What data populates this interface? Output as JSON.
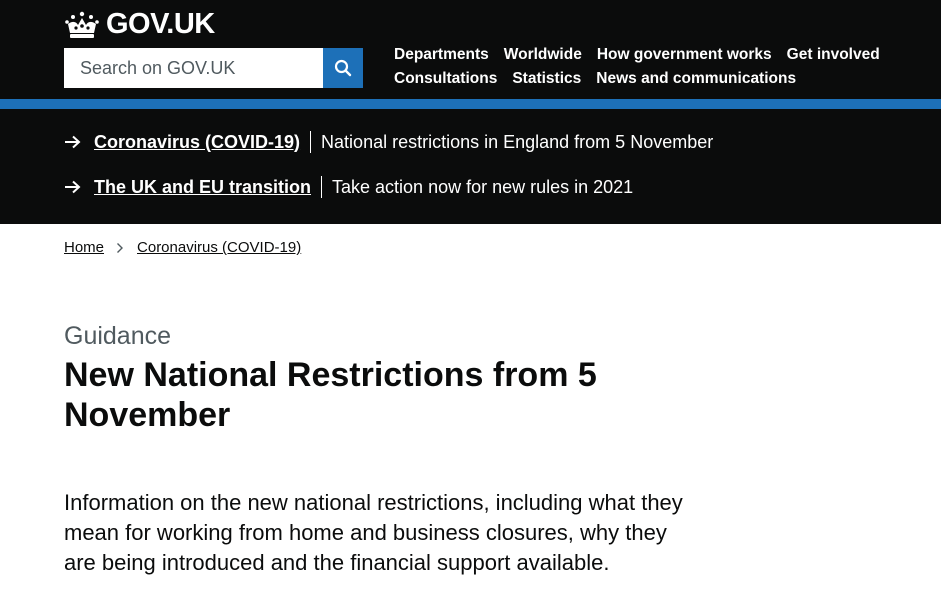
{
  "header": {
    "logo_text": "GOV.UK",
    "logo_icon": "crown-icon",
    "search": {
      "placeholder": "Search on GOV.UK",
      "button_icon": "search-icon"
    },
    "nav": {
      "row1": [
        "Departments",
        "Worldwide",
        "How government works",
        "Get involved"
      ],
      "row2": [
        "Consultations",
        "Statistics",
        "News and communications"
      ]
    }
  },
  "notices": [
    {
      "link": "Coronavirus (COVID-19)",
      "text": "National restrictions in England from 5 November"
    },
    {
      "link": "The UK and EU transition",
      "text": "Take action now for new rules in 2021"
    }
  ],
  "breadcrumb": [
    "Home",
    "Coronavirus (COVID-19)"
  ],
  "page": {
    "caption": "Guidance",
    "title": "New National Restrictions from 5 November",
    "lead": "Information on the new national restrictions, including what they mean for working from home and business closures, why they are being introduced and the financial support available."
  },
  "colors": {
    "header_bg": "#0b0c0c",
    "brand_blue": "#1d70b8",
    "secondary_text": "#505a5f"
  }
}
